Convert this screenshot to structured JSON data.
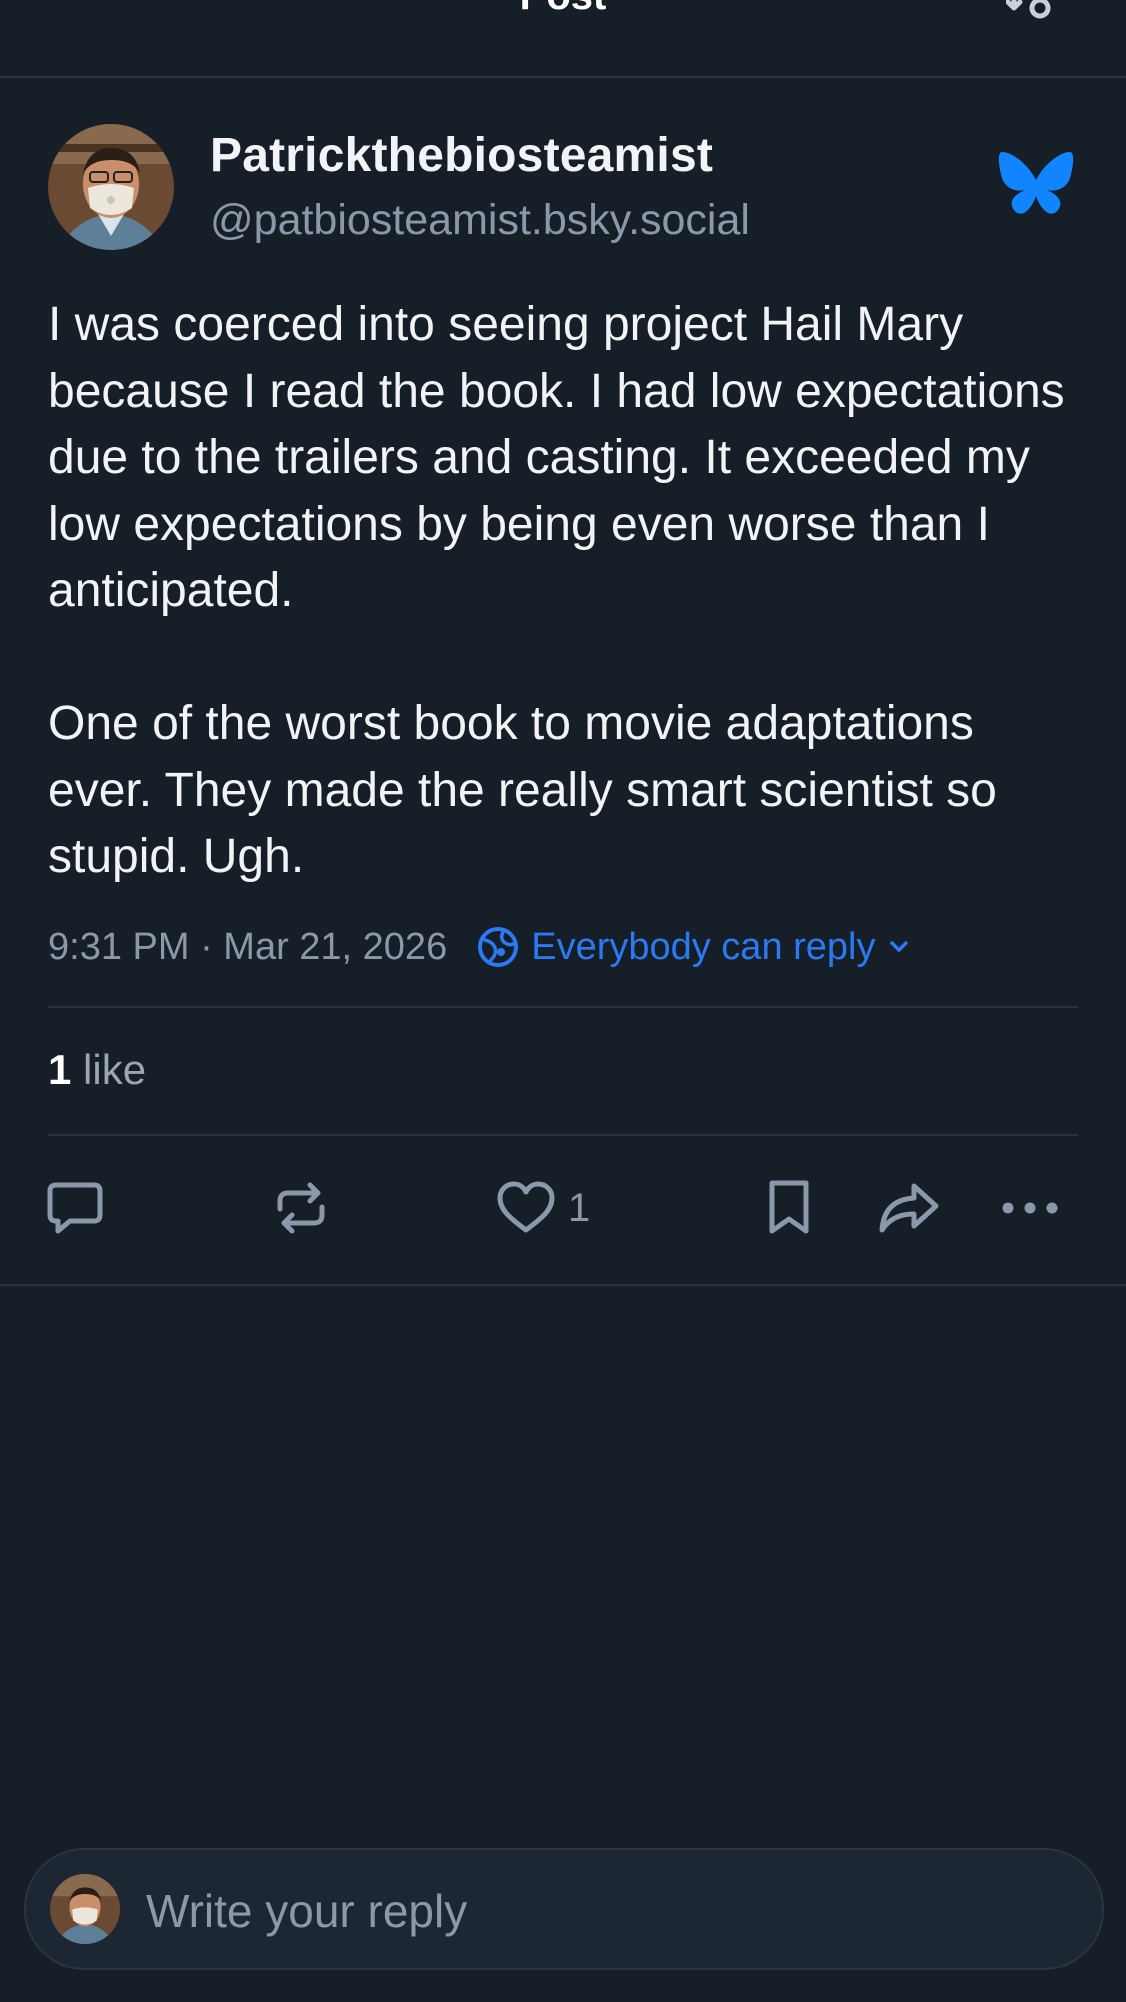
{
  "header": {
    "title": "Post"
  },
  "author": {
    "display_name": "Patrickthebiosteamist",
    "handle": "@patbiosteamist.bsky.social"
  },
  "post": {
    "paragraphs": [
      "I was coerced into seeing project Hail Mary because I read the book. I had low expectations due to the trailers and casting. It exceeded my low expectations by being even worse than I anticipated.",
      "One of the worst book to movie adaptations ever. They made the really smart scientist so stupid. Ugh."
    ],
    "timestamp": "9:31 PM · Mar 21, 2026",
    "reply_setting": "Everybody can reply"
  },
  "stats": {
    "like_count": "1",
    "like_label": "like"
  },
  "actions": {
    "like_count": "1"
  },
  "composer": {
    "placeholder": "Write your reply"
  },
  "colors": {
    "background": "#161e27",
    "accent": "#2b79f3",
    "muted": "#8b98a9"
  }
}
